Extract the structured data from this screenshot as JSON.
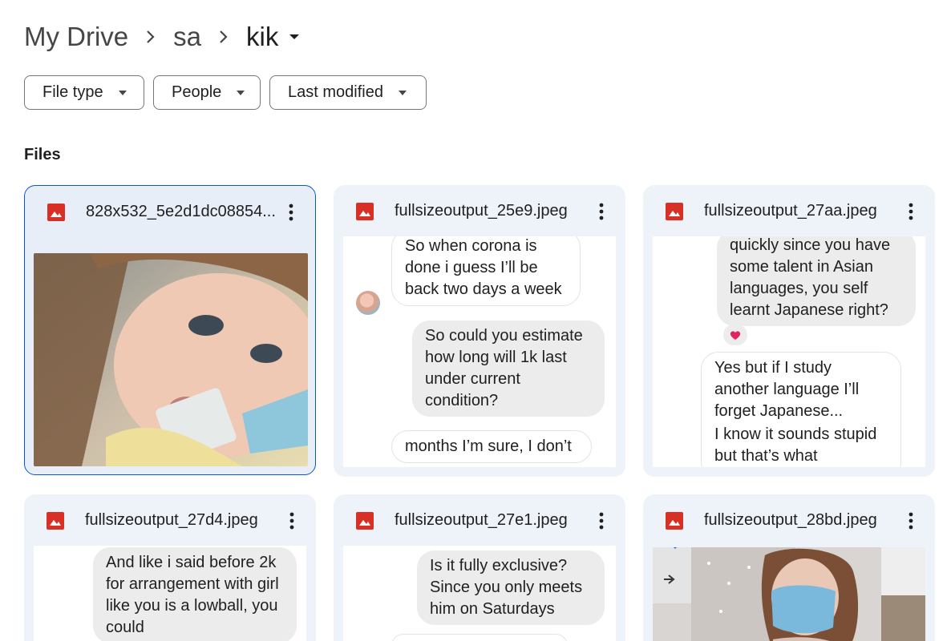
{
  "breadcrumb": {
    "root": "My Drive",
    "middle": "sa",
    "current": "kik"
  },
  "filters": [
    {
      "label": "File type"
    },
    {
      "label": "People"
    },
    {
      "label": "Last modified"
    }
  ],
  "section_title": "Files",
  "colors": {
    "accent": "#0b57d0",
    "image_icon": "#d93025",
    "card_bg": "#eef2f9"
  },
  "files": [
    {
      "name": "828x532_5e2d1dc08854...",
      "icon": "image-file-icon",
      "selected": true,
      "thumbnail": "photo"
    },
    {
      "name": "fullsizeoutput_25e9.jpeg",
      "icon": "image-file-icon",
      "thumbnail": "chat",
      "messages": [
        {
          "text": "So when corona is done i guess I’ll be back two days a week",
          "side": "left"
        },
        {
          "text": "So could you estimate how long will 1k last under current condition?",
          "side": "right"
        },
        {
          "text": "months I’m sure, I don’t",
          "side": "left"
        }
      ]
    },
    {
      "name": "fullsizeoutput_27aa.jpeg",
      "icon": "image-file-icon",
      "thumbnail": "chat",
      "messages": [
        {
          "text": "quickly since you have some talent in Asian languages, you self learnt Japanese right?",
          "side": "right"
        },
        {
          "text": "Yes but if I study another language I’ll forget Japanese...",
          "side": "left"
        },
        {
          "text": "I know it sounds stupid but that’s what",
          "side": "left"
        }
      ]
    },
    {
      "name": "fullsizeoutput_27d4.jpeg",
      "icon": "image-file-icon",
      "thumbnail": "chat",
      "messages": [
        {
          "text": "And like i said before 2k for arrangement with girl like you is a lowball, you could",
          "side": "right"
        }
      ]
    },
    {
      "name": "fullsizeoutput_27e1.jpeg",
      "icon": "image-file-icon",
      "thumbnail": "chat",
      "messages": [
        {
          "text": "Is it fully exclusive? Since you only meets him on Saturdays",
          "side": "right"
        }
      ]
    },
    {
      "name": "fullsizeoutput_28bd.jpeg",
      "icon": "image-file-icon",
      "thumbnail": "photo"
    }
  ]
}
